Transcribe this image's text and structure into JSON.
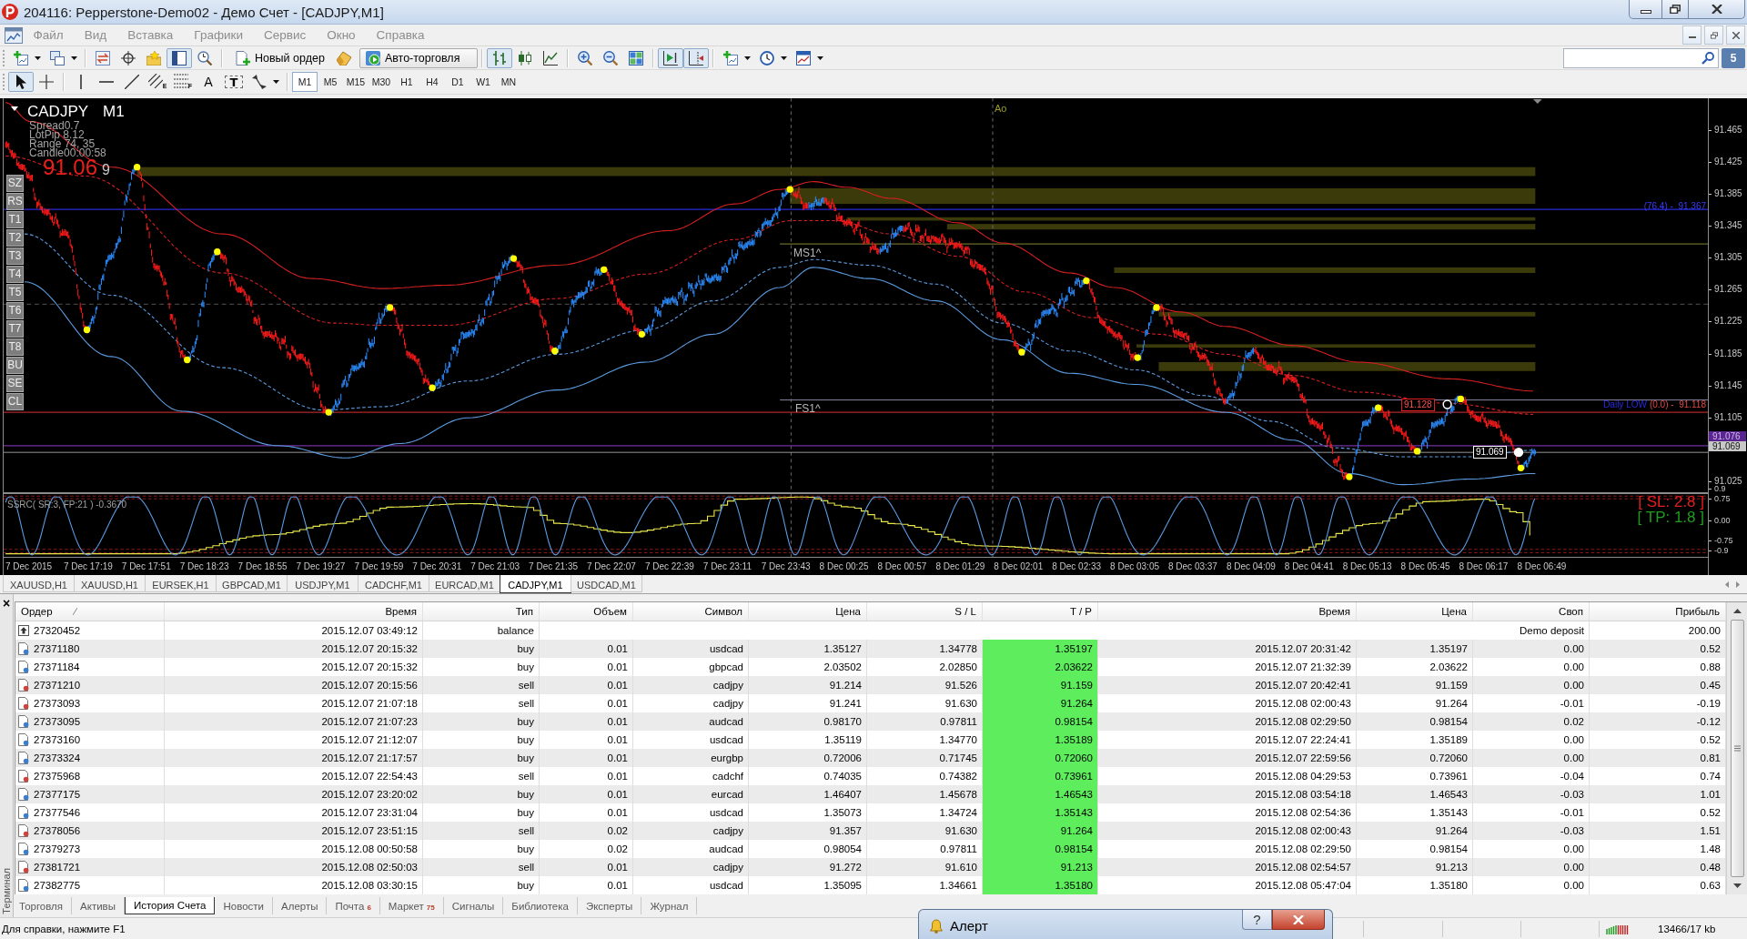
{
  "title_bar": {
    "title": "204116: Pepperstone-Demo02 - Демо Счет - [CADJPY,M1]"
  },
  "menu": {
    "items": [
      "Файл",
      "Вид",
      "Вставка",
      "Графики",
      "Сервис",
      "Окно",
      "Справка"
    ]
  },
  "toolbar": {
    "groups": [
      [
        {
          "pressed": false,
          "dropdown": true
        },
        {
          "pressed": false,
          "dropdown": true
        }
      ],
      [
        {
          "pressed": false
        },
        {
          "pressed": false
        },
        {
          "pressed": false
        },
        {
          "pressed": true
        },
        {
          "pressed": false
        }
      ],
      [
        {
          "label": "Новый ордер",
          "pressed": false
        },
        {
          "pressed": false
        },
        {
          "label": "Авто-торговля",
          "pressed": false
        }
      ],
      [
        {
          "pressed": true
        },
        {
          "pressed": false
        },
        {
          "pressed": false
        }
      ],
      [
        {
          "pressed": false
        },
        {
          "pressed": false
        },
        {
          "pressed": false
        }
      ],
      [
        {
          "pressed": true
        },
        {
          "pressed": true
        }
      ],
      [
        {
          "pressed": false,
          "dropdown": true
        },
        {
          "pressed": false,
          "dropdown": true
        },
        {
          "pressed": false,
          "dropdown": true
        }
      ]
    ],
    "messages": "5"
  },
  "drawing_toolbar": {
    "groups": [
      [
        {
          "pressed": true
        },
        {
          "pressed": false
        }
      ],
      [
        {
          "pressed": false
        },
        {
          "pressed": false
        },
        {
          "pressed": false
        },
        {
          "pressed": false,
          "glyph": "E"
        },
        {
          "pressed": false,
          "glyph": "F"
        },
        {
          "pressed": false,
          "glyph": "A"
        },
        {
          "pressed": false,
          "glyph": "T"
        },
        {
          "pressed": false,
          "dropdown": true
        }
      ]
    ],
    "timeframes": [
      {
        "label": "M1",
        "selected": true
      },
      {
        "label": "M5",
        "selected": false
      },
      {
        "label": "M15",
        "selected": false
      },
      {
        "label": "M30",
        "selected": false
      },
      {
        "label": "H1",
        "selected": false
      },
      {
        "label": "H4",
        "selected": false
      },
      {
        "label": "D1",
        "selected": false
      },
      {
        "label": "W1",
        "selected": false
      },
      {
        "label": "MN",
        "selected": false
      }
    ]
  },
  "chart": {
    "symbol": "CADJPY",
    "timeframe": "M1",
    "info": [
      "Spread0.7",
      "LotPip 8.12",
      "Range 74, 35",
      "Candle00:00:58"
    ],
    "bid_main": "91.06",
    "bid_last": "9",
    "side_buttons": [
      "SZ",
      "RS",
      "T1",
      "T2",
      "T3",
      "T4",
      "T5",
      "T6",
      "T7",
      "T8",
      "BU",
      "SE",
      "CL"
    ],
    "marks": [
      "Ao",
      "MS1^",
      "FS1^"
    ],
    "fibo_label": "(76.4) -  91.367",
    "daily_low": {
      "name": "Daily LOW",
      "value": "(0.0) -  91.118"
    },
    "price_tags": [
      "91.128",
      "91.069"
    ],
    "price_axis": [
      "91.465",
      "91.425",
      "91.385",
      "91.345",
      "91.305",
      "91.265",
      "91.225",
      "91.185",
      "91.145",
      "91.105",
      "91.025"
    ],
    "axis_tags": [
      {
        "text": "91.076",
        "color": "#5a2590"
      },
      {
        "text": "91.069",
        "color": "#c8c8c8"
      }
    ],
    "indicator": {
      "title": "SSRC( SR:3, FP:21 ) -0.3670",
      "sl": "[ SL: 2.8 ]",
      "tp": "[ TP: 1.8 ]",
      "axis": [
        "0.9",
        "0.75",
        "0.00",
        "-0.75",
        "-0.9"
      ]
    },
    "time_axis": [
      "7 Dec 2015",
      "7 Dec 17:19",
      "7 Dec 17:51",
      "7 Dec 18:23",
      "7 Dec 18:55",
      "7 Dec 19:27",
      "7 Dec 19:59",
      "7 Dec 20:31",
      "7 Dec 21:03",
      "7 Dec 21:35",
      "7 Dec 22:07",
      "7 Dec 22:39",
      "7 Dec 23:11",
      "7 Dec 23:43",
      "8 Dec 00:25",
      "8 Dec 00:57",
      "8 Dec 01:29",
      "8 Dec 02:01",
      "8 Dec 02:33",
      "8 Dec 03:05",
      "8 Dec 03:37",
      "8 Dec 04:09",
      "8 Dec 04:41",
      "8 Dec 05:13",
      "8 Dec 05:45",
      "8 Dec 06:17",
      "8 Dec 06:49"
    ]
  },
  "chart_tabs": [
    {
      "label": "XAUUSD,H1",
      "selected": false
    },
    {
      "label": "XAUUSD,H1",
      "selected": false
    },
    {
      "label": "EURSEK,H1",
      "selected": false
    },
    {
      "label": "GBPCAD,M1",
      "selected": false
    },
    {
      "label": "USDJPY,M1",
      "selected": false
    },
    {
      "label": "CADCHF,M1",
      "selected": false
    },
    {
      "label": "EURCAD,M1",
      "selected": false
    },
    {
      "label": "CADJPY,M1",
      "selected": true
    },
    {
      "label": "USDCAD,M1",
      "selected": false
    }
  ],
  "terminal": {
    "close": "×",
    "side_label": "Терминал",
    "columns": [
      {
        "label": "Ордер",
        "sorted": true
      },
      {
        "label": "Время",
        "sorted": false
      },
      {
        "label": "Тип",
        "sorted": false
      },
      {
        "label": "Объем",
        "sorted": false
      },
      {
        "label": "Символ",
        "sorted": false
      },
      {
        "label": "Цена",
        "sorted": false
      },
      {
        "label": "S / L",
        "sorted": false
      },
      {
        "label": "T / P",
        "sorted": false
      },
      {
        "label": "Время",
        "sorted": false
      },
      {
        "label": "Цена",
        "sorted": false
      },
      {
        "label": "Своп",
        "sorted": false
      },
      {
        "label": "Прибыль",
        "sorted": false
      }
    ],
    "rows": [
      {
        "kind": "balance",
        "order": "27320452",
        "open_time": "2015.12.07 03:49:12",
        "type": "balance",
        "comment": "Demo deposit",
        "profit": "200.00"
      },
      {
        "kind": "buy",
        "order": "27371180",
        "open_time": "2015.12.07 20:15:32",
        "type": "buy",
        "volume": "0.01",
        "symbol": "usdcad",
        "price": "1.35127",
        "sl": "1.34778",
        "tp": "1.35197",
        "tp_hit": true,
        "close_time": "2015.12.07 20:31:42",
        "close_price": "1.35197",
        "swap": "0.00",
        "profit": "0.52"
      },
      {
        "kind": "buy",
        "order": "27371184",
        "open_time": "2015.12.07 20:15:32",
        "type": "buy",
        "volume": "0.01",
        "symbol": "gbpcad",
        "price": "2.03502",
        "sl": "2.02850",
        "tp": "2.03622",
        "tp_hit": true,
        "close_time": "2015.12.07 21:32:39",
        "close_price": "2.03622",
        "swap": "0.00",
        "profit": "0.88"
      },
      {
        "kind": "sell",
        "order": "27371210",
        "open_time": "2015.12.07 20:15:56",
        "type": "sell",
        "volume": "0.01",
        "symbol": "cadjpy",
        "price": "91.214",
        "sl": "91.526",
        "tp": "91.159",
        "tp_hit": true,
        "close_time": "2015.12.07 20:42:41",
        "close_price": "91.159",
        "swap": "0.00",
        "profit": "0.45"
      },
      {
        "kind": "sell",
        "order": "27373093",
        "open_time": "2015.12.07 21:07:18",
        "type": "sell",
        "volume": "0.01",
        "symbol": "cadjpy",
        "price": "91.241",
        "sl": "91.630",
        "tp": "91.264",
        "tp_hit": true,
        "close_time": "2015.12.08 02:00:43",
        "close_price": "91.264",
        "swap": "-0.01",
        "profit": "-0.19"
      },
      {
        "kind": "buy",
        "order": "27373095",
        "open_time": "2015.12.07 21:07:23",
        "type": "buy",
        "volume": "0.01",
        "symbol": "audcad",
        "price": "0.98170",
        "sl": "0.97811",
        "tp": "0.98154",
        "tp_hit": true,
        "close_time": "2015.12.08 02:29:50",
        "close_price": "0.98154",
        "swap": "0.02",
        "profit": "-0.12"
      },
      {
        "kind": "buy",
        "order": "27373160",
        "open_time": "2015.12.07 21:12:07",
        "type": "buy",
        "volume": "0.01",
        "symbol": "usdcad",
        "price": "1.35119",
        "sl": "1.34770",
        "tp": "1.35189",
        "tp_hit": true,
        "close_time": "2015.12.07 22:24:41",
        "close_price": "1.35189",
        "swap": "0.00",
        "profit": "0.52"
      },
      {
        "kind": "buy",
        "order": "27373324",
        "open_time": "2015.12.07 21:17:57",
        "type": "buy",
        "volume": "0.01",
        "symbol": "eurgbp",
        "price": "0.72006",
        "sl": "0.71745",
        "tp": "0.72060",
        "tp_hit": true,
        "close_time": "2015.12.07 22:59:56",
        "close_price": "0.72060",
        "swap": "0.00",
        "profit": "0.81"
      },
      {
        "kind": "sell",
        "order": "27375968",
        "open_time": "2015.12.07 22:54:43",
        "type": "sell",
        "volume": "0.01",
        "symbol": "cadchf",
        "price": "0.74035",
        "sl": "0.74382",
        "tp": "0.73961",
        "tp_hit": true,
        "close_time": "2015.12.08 04:29:53",
        "close_price": "0.73961",
        "swap": "-0.04",
        "profit": "0.74"
      },
      {
        "kind": "buy",
        "order": "27377175",
        "open_time": "2015.12.07 23:20:02",
        "type": "buy",
        "volume": "0.01",
        "symbol": "eurcad",
        "price": "1.46407",
        "sl": "1.45678",
        "tp": "1.46543",
        "tp_hit": true,
        "close_time": "2015.12.08 03:54:18",
        "close_price": "1.46543",
        "swap": "-0.03",
        "profit": "1.01"
      },
      {
        "kind": "buy",
        "order": "27377546",
        "open_time": "2015.12.07 23:31:04",
        "type": "buy",
        "volume": "0.01",
        "symbol": "usdcad",
        "price": "1.35073",
        "sl": "1.34724",
        "tp": "1.35143",
        "tp_hit": true,
        "close_time": "2015.12.08 02:54:36",
        "close_price": "1.35143",
        "swap": "-0.01",
        "profit": "0.52"
      },
      {
        "kind": "sell",
        "order": "27378056",
        "open_time": "2015.12.07 23:51:15",
        "type": "sell",
        "volume": "0.02",
        "symbol": "cadjpy",
        "price": "91.357",
        "sl": "91.630",
        "tp": "91.264",
        "tp_hit": true,
        "close_time": "2015.12.08 02:00:43",
        "close_price": "91.264",
        "swap": "-0.03",
        "profit": "1.51"
      },
      {
        "kind": "buy",
        "order": "27379273",
        "open_time": "2015.12.08 00:50:58",
        "type": "buy",
        "volume": "0.02",
        "symbol": "audcad",
        "price": "0.98054",
        "sl": "0.97811",
        "tp": "0.98154",
        "tp_hit": true,
        "close_time": "2015.12.08 02:29:50",
        "close_price": "0.98154",
        "swap": "0.00",
        "profit": "1.48"
      },
      {
        "kind": "sell",
        "order": "27381721",
        "open_time": "2015.12.08 02:50:03",
        "type": "sell",
        "volume": "0.01",
        "symbol": "cadjpy",
        "price": "91.272",
        "sl": "91.610",
        "tp": "91.213",
        "tp_hit": true,
        "close_time": "2015.12.08 02:54:57",
        "close_price": "91.213",
        "swap": "0.00",
        "profit": "0.48"
      },
      {
        "kind": "buy",
        "order": "27382775",
        "open_time": "2015.12.08 03:30:15",
        "type": "buy",
        "volume": "0.01",
        "symbol": "usdcad",
        "price": "1.35095",
        "sl": "1.34661",
        "tp": "1.35180",
        "tp_hit": true,
        "close_time": "2015.12.08 05:47:04",
        "close_price": "1.35180",
        "swap": "0.00",
        "profit": "0.63"
      }
    ],
    "tabs": [
      {
        "label": "Торговля",
        "selected": false
      },
      {
        "label": "Активы",
        "selected": false
      },
      {
        "label": "История Счета",
        "selected": true
      },
      {
        "label": "Новости",
        "selected": false
      },
      {
        "label": "Алерты",
        "selected": false
      },
      {
        "label": "Почта",
        "badge": "6",
        "selected": false
      },
      {
        "label": "Маркет",
        "badge": "75",
        "selected": false
      },
      {
        "label": "Сигналы",
        "selected": false
      },
      {
        "label": "Библиотека",
        "selected": false
      },
      {
        "label": "Эксперты",
        "selected": false
      },
      {
        "label": "Журнал",
        "selected": false
      }
    ]
  },
  "status_bar": {
    "help": "Для справки, нажмите F1",
    "traffic": "13466/17 kb"
  },
  "alert": {
    "title": "Алерт",
    "help": "?"
  }
}
